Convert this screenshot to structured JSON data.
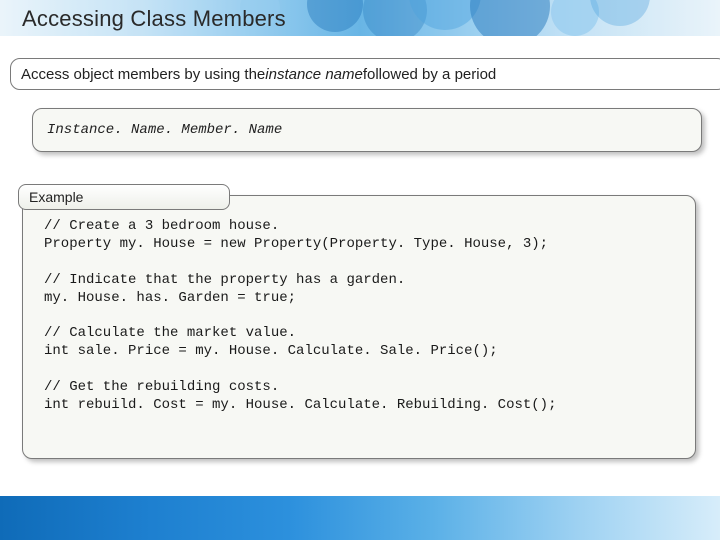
{
  "title": "Accessing Class Members",
  "access_line": {
    "pre": "Access object members by using the ",
    "italic": "instance name",
    "post": " followed by a period"
  },
  "syntax_line": "Instance. Name. Member. Name",
  "example_label": "Example",
  "code": "// Create a 3 bedroom house.\nProperty my. House = new Property(Property. Type. House, 3);\n\n// Indicate that the property has a garden.\nmy. House. has. Garden = true;\n\n// Calculate the market value.\nint sale. Price = my. House. Calculate. Sale. Price();\n\n// Get the rebuilding costs.\nint rebuild. Cost = my. House. Calculate. Rebuilding. Cost();"
}
